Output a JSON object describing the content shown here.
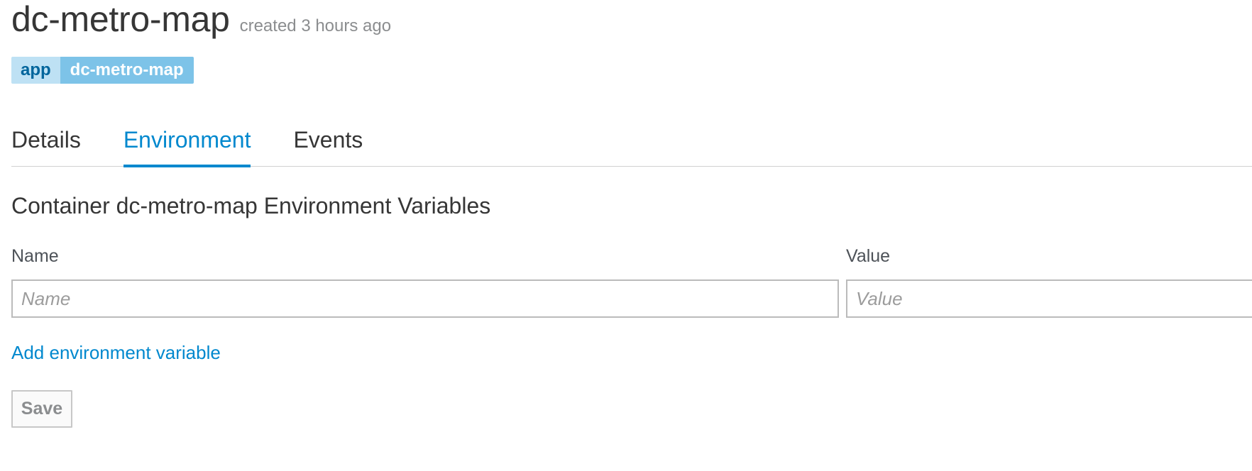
{
  "header": {
    "title": "dc-metro-map",
    "created": "created 3 hours ago"
  },
  "labels": [
    {
      "key": "app",
      "value": "dc-metro-map"
    }
  ],
  "tabs": [
    {
      "label": "Details",
      "active": false
    },
    {
      "label": "Environment",
      "active": true
    },
    {
      "label": "Events",
      "active": false
    }
  ],
  "environment": {
    "section_title": "Container dc-metro-map Environment Variables",
    "name_label": "Name",
    "value_label": "Value",
    "name_placeholder": "Name",
    "value_placeholder": "Value",
    "name_value": "",
    "value_value": "",
    "add_link": "Add environment variable",
    "save_label": "Save"
  },
  "colors": {
    "accent": "#0088ce",
    "label_key_bg": "#bee1f4",
    "label_value_bg": "#7dc3e8"
  }
}
